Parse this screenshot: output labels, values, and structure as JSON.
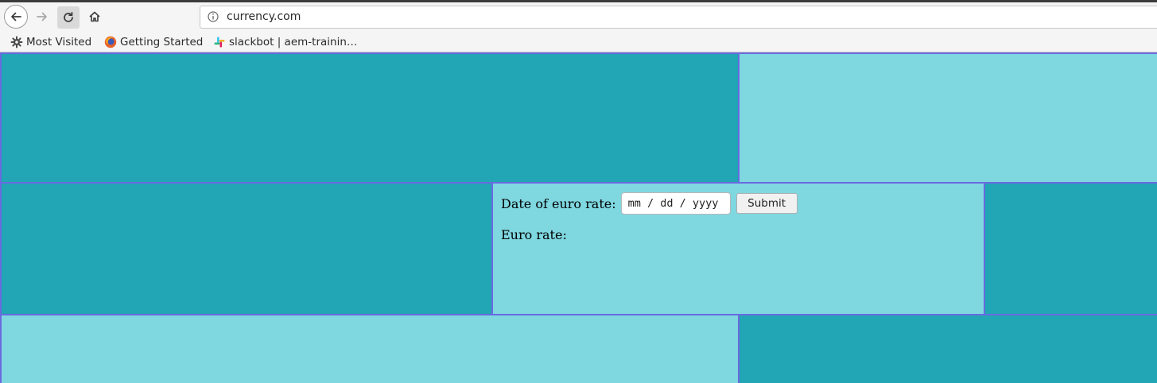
{
  "browser": {
    "url": "currency.com",
    "bookmarks": [
      {
        "label": "Most Visited",
        "icon": "gear-icon"
      },
      {
        "label": "Getting Started",
        "icon": "firefox-icon"
      },
      {
        "label": "slackbot | aem-trainin…",
        "icon": "slack-icon"
      }
    ]
  },
  "form": {
    "date_label": "Date of euro rate:",
    "date_placeholder": "mm / dd / yyyy",
    "submit_label": "Submit",
    "rate_label": "Euro rate:",
    "rate_value": ""
  },
  "colors": {
    "dark_cell": "#22a5b4",
    "light_cell": "#7fd7e0",
    "cell_border": "#6a6ae0"
  }
}
